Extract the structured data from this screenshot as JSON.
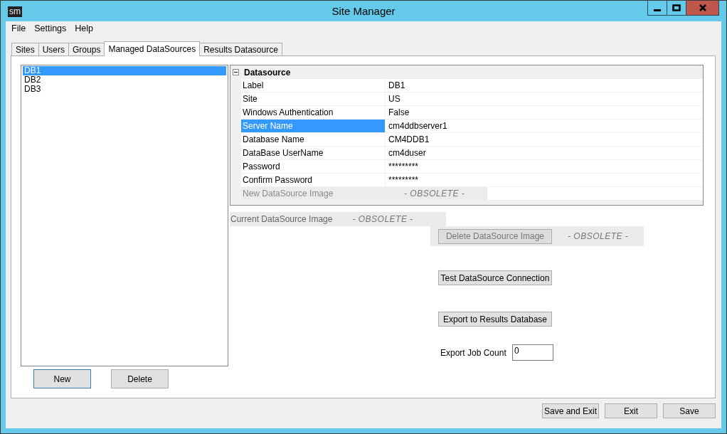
{
  "window": {
    "title": "Site Manager",
    "app_icon": "sm"
  },
  "menu": [
    "File",
    "Settings",
    "Help"
  ],
  "tabs": [
    {
      "label": "Sites",
      "selected": false
    },
    {
      "label": "Users",
      "selected": false
    },
    {
      "label": "Groups",
      "selected": false
    },
    {
      "label": "Managed DataSources",
      "selected": true
    },
    {
      "label": "Results Datasource",
      "selected": false
    }
  ],
  "datasources": [
    {
      "label": "DB1",
      "selected": true
    },
    {
      "label": "DB2",
      "selected": false
    },
    {
      "label": "DB3",
      "selected": false
    }
  ],
  "list_buttons": [
    {
      "label": "New",
      "default": true
    },
    {
      "label": "Delete",
      "default": false
    }
  ],
  "property_grid": {
    "category": "Datasource",
    "expanded": true,
    "rows": [
      {
        "label": "Label",
        "value": "DB1",
        "selected": false,
        "disabled": false
      },
      {
        "label": "Site",
        "value": "US",
        "selected": false,
        "disabled": false
      },
      {
        "label": "Windows Authentication",
        "value": "False",
        "selected": false,
        "disabled": false
      },
      {
        "label": "Server Name",
        "value": "cm4ddbserver1",
        "selected": true,
        "disabled": false
      },
      {
        "label": "Database Name",
        "value": "CM4DDB1",
        "selected": false,
        "disabled": false
      },
      {
        "label": "DataBase UserName",
        "value": "cm4duser",
        "selected": false,
        "disabled": false
      },
      {
        "label": "Password",
        "value": "*********",
        "selected": false,
        "disabled": false
      },
      {
        "label": "Confirm Password",
        "value": "*********",
        "selected": false,
        "disabled": false
      },
      {
        "label": "New DataSource Image",
        "value": "- OBSOLETE -",
        "selected": false,
        "disabled": true
      }
    ]
  },
  "current_image": {
    "label": "Current DataSource Image",
    "note": "- OBSOLETE -"
  },
  "delete_image": {
    "label": "Delete DataSource Image",
    "disabled": true,
    "note": "- OBSOLETE -"
  },
  "test_button": "Test DataSource Connection",
  "export_button": "Export to Results Database",
  "export_job_count": {
    "label": "Export Job Count",
    "value": "0"
  },
  "footer_buttons": [
    "Save and Exit",
    "Exit",
    "Save"
  ]
}
